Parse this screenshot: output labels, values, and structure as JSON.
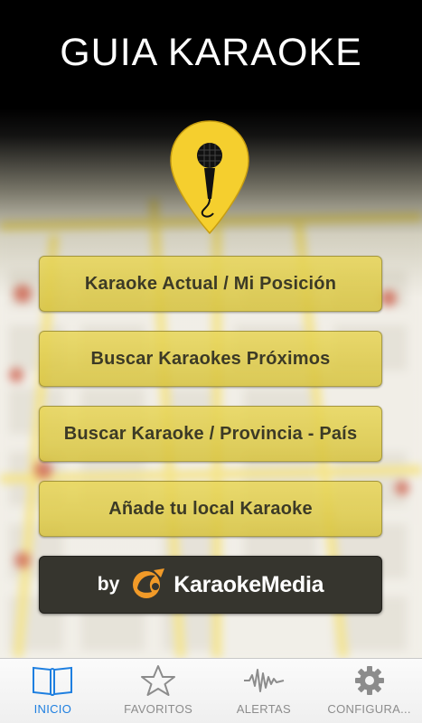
{
  "header": {
    "title": "GUIA KARAOKE"
  },
  "logo": {
    "icon": "microphone-pin-icon",
    "color": "#f5cf2e"
  },
  "menu": {
    "items": [
      {
        "label": "Karaoke Actual / Mi Posición"
      },
      {
        "label": "Buscar Karaokes Próximos"
      },
      {
        "label": "Buscar Karaoke / Provincia - País"
      },
      {
        "label": "Añade tu local Karaoke"
      }
    ]
  },
  "sponsor": {
    "by": "by",
    "brand": "KaraokeMedia"
  },
  "tabbar": {
    "tabs": [
      {
        "label": "INICIO",
        "icon": "book-icon",
        "active": true
      },
      {
        "label": "FAVORITOS",
        "icon": "star-icon",
        "active": false
      },
      {
        "label": "ALERTAS",
        "icon": "waveform-icon",
        "active": false
      },
      {
        "label": "CONFIGURA...",
        "icon": "gear-icon",
        "active": false
      }
    ],
    "active_color": "#1e7fe0",
    "inactive_color": "#8c8c8c"
  }
}
